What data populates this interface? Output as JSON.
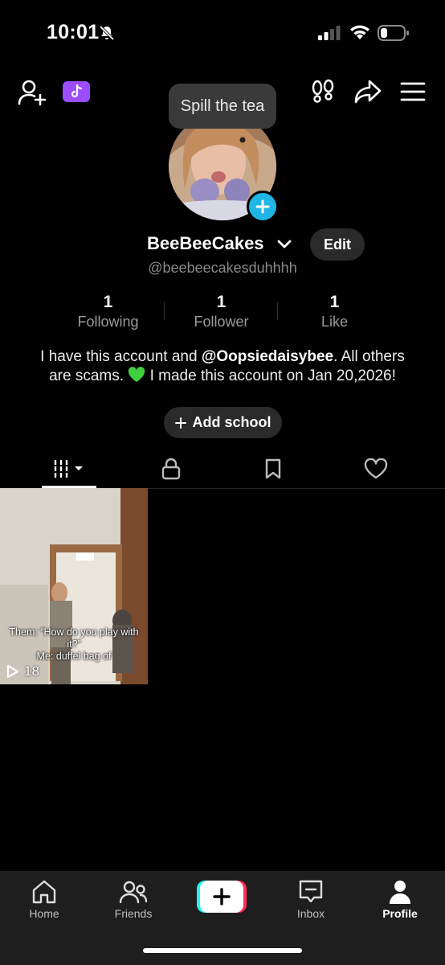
{
  "status_bar": {
    "time": "10:01"
  },
  "header": {
    "bubble_text": "Spill the tea",
    "icons": [
      "add-friend-icon",
      "tiktok-badge-icon",
      "footprint-icon",
      "share-icon",
      "menu-icon"
    ]
  },
  "profile": {
    "display_name": "BeeBeeCakes",
    "handle": "@beebeecakesduhhhh",
    "edit_label": "Edit",
    "stats": [
      {
        "value": "1",
        "label": "Following"
      },
      {
        "value": "1",
        "label": "Follower"
      },
      {
        "value": "1",
        "label": "Like"
      }
    ],
    "bio": {
      "part1": "I have this account and ",
      "mention": "@Oopsiedaisybee",
      "part2": ". All others are scams. ",
      "part3": " I made this account on Jan 20,2026!"
    },
    "add_school_label": "Add school"
  },
  "videos": [
    {
      "caption_line1": "Them: “How do you play with it?”",
      "caption_line2": "Me: duffel bag of",
      "views": "18"
    }
  ],
  "bottom_nav": {
    "home": "Home",
    "friends": "Friends",
    "inbox": "Inbox",
    "profile": "Profile"
  },
  "colors": {
    "accent_blue": "#1fb6e5",
    "badge_purple": "#9b4dff",
    "tiktok_cyan": "#25f4ee",
    "tiktok_red": "#fe2c55"
  }
}
